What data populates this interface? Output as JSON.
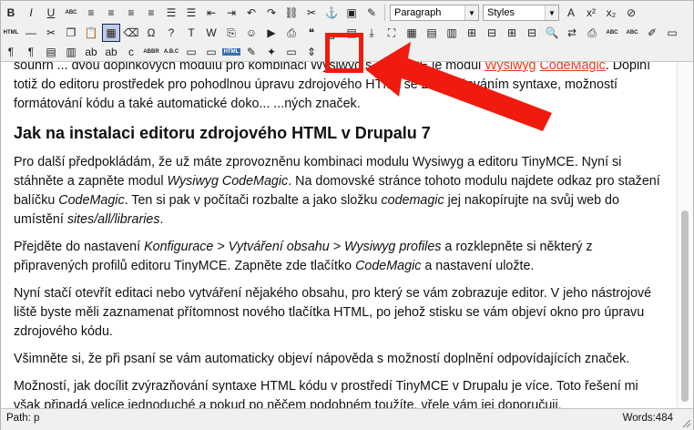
{
  "toolbar": {
    "row1": [
      {
        "name": "bold-button",
        "glyph": "B"
      },
      {
        "name": "italic-button",
        "glyph": "I"
      },
      {
        "name": "underline-button",
        "glyph": "U"
      },
      {
        "name": "strikethrough-button",
        "glyph": "ABC"
      },
      {
        "name": "align-left-button",
        "glyph": "≡"
      },
      {
        "name": "align-center-button",
        "glyph": "≡"
      },
      {
        "name": "align-right-button",
        "glyph": "≡"
      },
      {
        "name": "align-justify-button",
        "glyph": "≡"
      },
      {
        "name": "bullet-list-button",
        "glyph": "☰"
      },
      {
        "name": "numbered-list-button",
        "glyph": "☰"
      },
      {
        "name": "outdent-button",
        "glyph": "⇤"
      },
      {
        "name": "indent-button",
        "glyph": "⇥"
      },
      {
        "name": "undo-button",
        "glyph": "↶"
      },
      {
        "name": "redo-button",
        "glyph": "↷"
      },
      {
        "name": "link-button",
        "glyph": "⛓"
      },
      {
        "name": "unlink-button",
        "glyph": "✂"
      },
      {
        "name": "anchor-button",
        "glyph": "⚓"
      },
      {
        "name": "image-button",
        "glyph": "▣"
      },
      {
        "name": "cleanup-button",
        "glyph": "✎"
      }
    ],
    "format_select": "Paragraph",
    "styles_select": "Styles",
    "row1_right": [
      {
        "name": "forecolor-button",
        "glyph": "A"
      },
      {
        "name": "superscript-button",
        "glyph": "x²"
      },
      {
        "name": "subscript-button",
        "glyph": "x₂"
      },
      {
        "name": "removeformat-button",
        "glyph": "⊘"
      }
    ],
    "row2": [
      {
        "name": "html-code-button",
        "glyph": "HTML"
      },
      {
        "name": "hr-button",
        "glyph": "—"
      },
      {
        "name": "cut-button",
        "glyph": "✂"
      },
      {
        "name": "copy-button",
        "glyph": "❐"
      },
      {
        "name": "paste-button",
        "glyph": "📋"
      },
      {
        "name": "visualaid-button",
        "glyph": "▦"
      },
      {
        "name": "cleanup2-button",
        "glyph": "⌫"
      },
      {
        "name": "charmap-button",
        "glyph": "Ω"
      },
      {
        "name": "help-button",
        "glyph": "?"
      },
      {
        "name": "paste-text-button",
        "glyph": "T"
      },
      {
        "name": "paste-word-button",
        "glyph": "W"
      },
      {
        "name": "select-all-button",
        "glyph": "⎘"
      },
      {
        "name": "emotion-button",
        "glyph": "☺"
      },
      {
        "name": "media-button",
        "glyph": "▶"
      },
      {
        "name": "print-button",
        "glyph": "⎙"
      },
      {
        "name": "blockquote-button",
        "glyph": "❝"
      },
      {
        "name": "nonbreaking-button",
        "glyph": "⍽"
      },
      {
        "name": "template-button",
        "glyph": "▤"
      },
      {
        "name": "pagebreak-button",
        "glyph": "⤓"
      },
      {
        "name": "fullscreen-button",
        "glyph": "⛶"
      },
      {
        "name": "table-button",
        "glyph": "▦"
      },
      {
        "name": "row-props-button",
        "glyph": "▤"
      },
      {
        "name": "cell-props-button",
        "glyph": "▥"
      },
      {
        "name": "insert-row-button",
        "glyph": "⊞"
      },
      {
        "name": "delete-row-button",
        "glyph": "⊟"
      },
      {
        "name": "insert-col-button",
        "glyph": "⊞"
      },
      {
        "name": "delete-col-button",
        "glyph": "⊟"
      },
      {
        "name": "search-button",
        "glyph": "🔍"
      },
      {
        "name": "replace-button",
        "glyph": "⇄"
      },
      {
        "name": "print2-button",
        "glyph": "⎙"
      },
      {
        "name": "spellcheck-button",
        "glyph": "ABC"
      },
      {
        "name": "spellcheck2-button",
        "glyph": "ABC"
      },
      {
        "name": "styleprops-button",
        "glyph": "✐"
      },
      {
        "name": "attribs-button",
        "glyph": "▭"
      }
    ],
    "row3": [
      {
        "name": "ltr-button",
        "glyph": "¶"
      },
      {
        "name": "rtl-button",
        "glyph": "¶"
      },
      {
        "name": "layer-button",
        "glyph": "▤"
      },
      {
        "name": "abs-button",
        "glyph": "▥"
      },
      {
        "name": "ins-button",
        "glyph": "ab"
      },
      {
        "name": "del-button",
        "glyph": "ab"
      },
      {
        "name": "cite-button",
        "glyph": "c"
      },
      {
        "name": "acronym-button",
        "glyph": "ABBR"
      },
      {
        "name": "abbr-button",
        "glyph": "A.B.C"
      },
      {
        "name": "insertdate-button",
        "glyph": "▭"
      },
      {
        "name": "inserttime-button",
        "glyph": "▭"
      },
      {
        "name": "codemagic-html-button",
        "glyph": "HTML"
      },
      {
        "name": "pencil-button",
        "glyph": "✎"
      },
      {
        "name": "wand-button",
        "glyph": "✦"
      },
      {
        "name": "doc-button",
        "glyph": "▭"
      },
      {
        "name": "split-button",
        "glyph": "⇕"
      }
    ]
  },
  "content": {
    "p0_prefix": "",
    "p0_text1": "Doplní totiž do editoru prostředek pro pohodlnou úpravu zdrojového HTML se zvýrazňováním syntaxe, možností formátování kódu a také automatické doko... ...ných značek.",
    "p0_top": "souhrn ... dvou doplňkových modulů pro kombinaci Wysiwyg s TinyMCE je modul",
    "p0_link1": "Wysiwyg",
    "p0_link2": "CodeMagic",
    "heading": "Jak na instalaci editoru zdrojového HTML v Drupalu 7",
    "p1": {
      "a": "Pro další předpokládám, že už máte zprovozněnu kombinaci modulu Wysiwyg a editoru TinyMCE. Nyní si stáhněte a zapněte modul ",
      "a_em": "Wysiwyg CodeMagic",
      "b": ". Na domovské stránce tohoto modulu najdete odkaz pro stažení balíčku ",
      "b_em": "CodeMagic",
      "c": ". Ten si pak v počítači rozbalte a jako složku ",
      "c_em": "codemagic",
      "d": " jej nakopírujte na svůj web do umístění ",
      "d_em": "sites/all/libraries",
      "e": "."
    },
    "p2": {
      "a": "Přejděte do nastavení ",
      "a_em": "Konfigurace > Vytváření obsahu > Wysiwyg profiles",
      "b": " a rozklepněte si některý z připravených profilů editoru TinyMCE. Zapněte zde tlačítko ",
      "b_em": "CodeMagic",
      "c": " a nastavení uložte."
    },
    "p3": "Nyní stačí otevřít editaci nebo vytváření nějakého obsahu, pro který se vám zobrazuje editor. V jeho nástrojové liště byste měli zaznamenat přítomnost nového tlačítka HTML, po jehož stisku se vám objeví okno pro úpravu zdrojového kódu.",
    "p4": "Všimněte si, že při psaní se vám automaticky objeví nápověda s možností doplnění odpovídajících značek.",
    "p5": "Možností, jak docílit zvýrazňování syntaxe HTML kódu v prostředí TinyMCE v Drupalu je více. Toto řešení mi však připadá velice jednoduché a pokud po něčem podobném toužíte, vřele vám jej doporučuji."
  },
  "statusbar": {
    "path": "Path: p",
    "words": "Words:484"
  },
  "colors": {
    "highlight": "#f01b0e",
    "link": "#e43d0b"
  }
}
